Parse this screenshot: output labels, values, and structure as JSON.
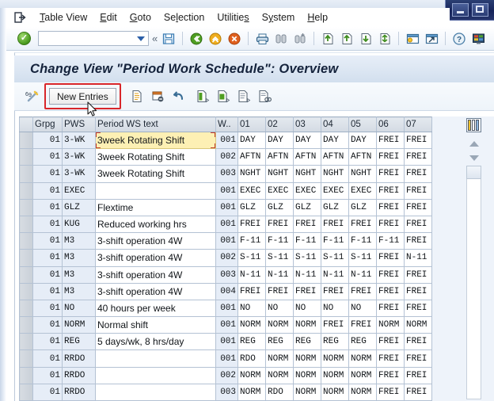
{
  "window": {
    "controls": [
      {
        "name": "minimize",
        "glyph": "minimize-icon"
      },
      {
        "name": "restore",
        "glyph": "restore-icon"
      }
    ]
  },
  "menubar": {
    "leading_icon": "session-exit-icon",
    "items": [
      {
        "label": "Table View",
        "accel": "T"
      },
      {
        "label": "Edit",
        "accel": "E"
      },
      {
        "label": "Goto",
        "accel": "G"
      },
      {
        "label": "Selection",
        "accel": "l"
      },
      {
        "label": "Utilities",
        "accel": "s"
      },
      {
        "label": "System",
        "accel": "y"
      },
      {
        "label": "Help",
        "accel": "H"
      }
    ]
  },
  "toolbar": {
    "enter_tooltip": "Enter",
    "command_field_value": "",
    "command_field_placeholder": "",
    "buttons": [
      {
        "name": "save-button",
        "icon": "floppy-save-icon"
      },
      {
        "name": "back-button",
        "icon": "green-back-icon"
      },
      {
        "name": "exit-button",
        "icon": "yellow-up-exit-icon"
      },
      {
        "name": "cancel-button",
        "icon": "red-cancel-icon"
      },
      {
        "name": "print-button",
        "icon": "printer-icon"
      },
      {
        "name": "find-button",
        "icon": "binoculars-icon"
      },
      {
        "name": "find-next-button",
        "icon": "binoculars-plus-icon"
      },
      {
        "name": "first-page-button",
        "icon": "page-first-icon"
      },
      {
        "name": "previous-page-button",
        "icon": "page-up-icon"
      },
      {
        "name": "next-page-button",
        "icon": "page-down-icon"
      },
      {
        "name": "last-page-button",
        "icon": "page-last-icon"
      },
      {
        "name": "create-session-button",
        "icon": "new-session-icon"
      },
      {
        "name": "create-shortcut-button",
        "icon": "shortcut-icon"
      },
      {
        "name": "help-button",
        "icon": "help-question-icon"
      },
      {
        "name": "customize-button",
        "icon": "customize-layout-icon"
      }
    ]
  },
  "page": {
    "title": "Change View \"Period Work Schedule\": Overview"
  },
  "app_toolbar": {
    "wand_icon": "check-entries-wand-icon",
    "new_entries_label": "New Entries",
    "new_entries_highlighted": true,
    "highlight_color": "#d8262a",
    "buttons": [
      {
        "name": "copy-as-button",
        "icon": "copy-page-icon"
      },
      {
        "name": "delete-button",
        "icon": "delete-row-icon"
      },
      {
        "name": "undo-button",
        "icon": "undo-arrow-icon"
      },
      {
        "name": "select-all-button",
        "icon": "select-all-icon"
      },
      {
        "name": "select-block-button",
        "icon": "select-block-icon"
      },
      {
        "name": "deselect-all-button",
        "icon": "deselect-all-icon"
      },
      {
        "name": "variable-list-button",
        "icon": "variable-list-icon"
      }
    ]
  },
  "table": {
    "columns": [
      {
        "key": "sel",
        "label": ""
      },
      {
        "key": "grpg",
        "label": "Grpg"
      },
      {
        "key": "pws",
        "label": "PWS"
      },
      {
        "key": "text",
        "label": "Period WS text"
      },
      {
        "key": "w",
        "label": "W.."
      },
      {
        "key": "d1",
        "label": "01"
      },
      {
        "key": "d2",
        "label": "02"
      },
      {
        "key": "d3",
        "label": "03"
      },
      {
        "key": "d4",
        "label": "04"
      },
      {
        "key": "d5",
        "label": "05"
      },
      {
        "key": "d6",
        "label": "06"
      },
      {
        "key": "d7",
        "label": "07"
      }
    ],
    "selected_row_index": 0,
    "selected_cell_key": "text",
    "rows": [
      {
        "grpg": "01",
        "pws": "3-WK",
        "text": "3week Rotating Shift",
        "w": "001",
        "d1": "DAY",
        "d2": "DAY",
        "d3": "DAY",
        "d4": "DAY",
        "d5": "DAY",
        "d6": "FREI",
        "d7": "FREI"
      },
      {
        "grpg": "01",
        "pws": "3-WK",
        "text": "3week Rotating Shift",
        "w": "002",
        "d1": "AFTN",
        "d2": "AFTN",
        "d3": "AFTN",
        "d4": "AFTN",
        "d5": "AFTN",
        "d6": "FREI",
        "d7": "FREI"
      },
      {
        "grpg": "01",
        "pws": "3-WK",
        "text": "3week Rotating Shift",
        "w": "003",
        "d1": "NGHT",
        "d2": "NGHT",
        "d3": "NGHT",
        "d4": "NGHT",
        "d5": "NGHT",
        "d6": "FREI",
        "d7": "FREI"
      },
      {
        "grpg": "01",
        "pws": "EXEC",
        "text": "",
        "w": "001",
        "d1": "EXEC",
        "d2": "EXEC",
        "d3": "EXEC",
        "d4": "EXEC",
        "d5": "EXEC",
        "d6": "FREI",
        "d7": "FREI"
      },
      {
        "grpg": "01",
        "pws": "GLZ",
        "text": "Flextime",
        "w": "001",
        "d1": "GLZ",
        "d2": "GLZ",
        "d3": "GLZ",
        "d4": "GLZ",
        "d5": "GLZ",
        "d6": "FREI",
        "d7": "FREI"
      },
      {
        "grpg": "01",
        "pws": "KUG",
        "text": "Reduced working hrs",
        "w": "001",
        "d1": "FREI",
        "d2": "FREI",
        "d3": "FREI",
        "d4": "FREI",
        "d5": "FREI",
        "d6": "FREI",
        "d7": "FREI"
      },
      {
        "grpg": "01",
        "pws": "M3",
        "text": "3-shift operation 4W",
        "w": "001",
        "d1": "F-11",
        "d2": "F-11",
        "d3": "F-11",
        "d4": "F-11",
        "d5": "F-11",
        "d6": "F-11",
        "d7": "FREI"
      },
      {
        "grpg": "01",
        "pws": "M3",
        "text": "3-shift operation 4W",
        "w": "002",
        "d1": "S-11",
        "d2": "S-11",
        "d3": "S-11",
        "d4": "S-11",
        "d5": "S-11",
        "d6": "FREI",
        "d7": "N-11"
      },
      {
        "grpg": "01",
        "pws": "M3",
        "text": "3-shift operation 4W",
        "w": "003",
        "d1": "N-11",
        "d2": "N-11",
        "d3": "N-11",
        "d4": "N-11",
        "d5": "N-11",
        "d6": "FREI",
        "d7": "FREI"
      },
      {
        "grpg": "01",
        "pws": "M3",
        "text": "3-shift operation 4W",
        "w": "004",
        "d1": "FREI",
        "d2": "FREI",
        "d3": "FREI",
        "d4": "FREI",
        "d5": "FREI",
        "d6": "FREI",
        "d7": "FREI"
      },
      {
        "grpg": "01",
        "pws": "NO",
        "text": "40 hours per week",
        "w": "001",
        "d1": "NO",
        "d2": "NO",
        "d3": "NO",
        "d4": "NO",
        "d5": "NO",
        "d6": "FREI",
        "d7": "FREI"
      },
      {
        "grpg": "01",
        "pws": "NORM",
        "text": "Normal shift",
        "w": "001",
        "d1": "NORM",
        "d2": "NORM",
        "d3": "NORM",
        "d4": "FREI",
        "d5": "FREI",
        "d6": "NORM",
        "d7": "NORM"
      },
      {
        "grpg": "01",
        "pws": "REG",
        "text": "5 days/wk, 8 hrs/day",
        "w": "001",
        "d1": "REG",
        "d2": "REG",
        "d3": "REG",
        "d4": "REG",
        "d5": "REG",
        "d6": "FREI",
        "d7": "FREI"
      },
      {
        "grpg": "01",
        "pws": "RRDO",
        "text": "",
        "w": "001",
        "d1": "RDO",
        "d2": "NORM",
        "d3": "NORM",
        "d4": "NORM",
        "d5": "NORM",
        "d6": "FREI",
        "d7": "FREI"
      },
      {
        "grpg": "01",
        "pws": "RRDO",
        "text": "",
        "w": "002",
        "d1": "NORM",
        "d2": "NORM",
        "d3": "NORM",
        "d4": "NORM",
        "d5": "NORM",
        "d6": "FREI",
        "d7": "FREI"
      },
      {
        "grpg": "01",
        "pws": "RRDO",
        "text": "",
        "w": "003",
        "d1": "NORM",
        "d2": "RDO",
        "d3": "NORM",
        "d4": "NORM",
        "d5": "NORM",
        "d6": "FREI",
        "d7": "FREI"
      }
    ]
  },
  "right_rail": {
    "config_button": "table-settings-icon",
    "scroll_up": "scroll-up-icon",
    "scroll_down": "scroll-down-icon"
  }
}
